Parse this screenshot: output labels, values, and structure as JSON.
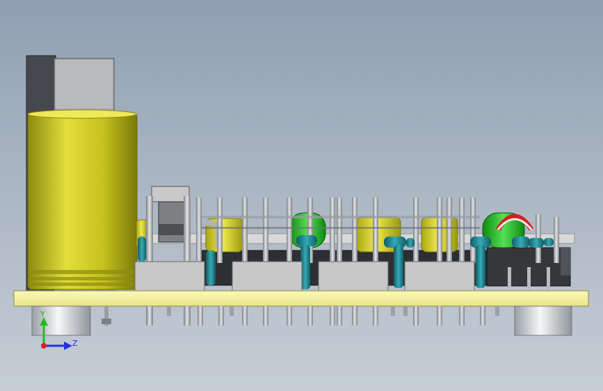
{
  "triad": {
    "y_label": "Y",
    "z_label": "Z",
    "colors": {
      "y": "#22bb22",
      "z": "#2233dd",
      "x": "#dd2222"
    }
  },
  "colors": {
    "background_top": "#8f9fb1",
    "background_bottom": "#c6cdd6",
    "pcb": "#f4f1a0",
    "capacitor": "#c8c41c",
    "component_dark": "#2d2f33",
    "connector_gray": "#c7c7c7",
    "pin_silver": "#b9bcc0",
    "inductor_green": "#22c422",
    "resistor_teal": "#1b7d88"
  }
}
